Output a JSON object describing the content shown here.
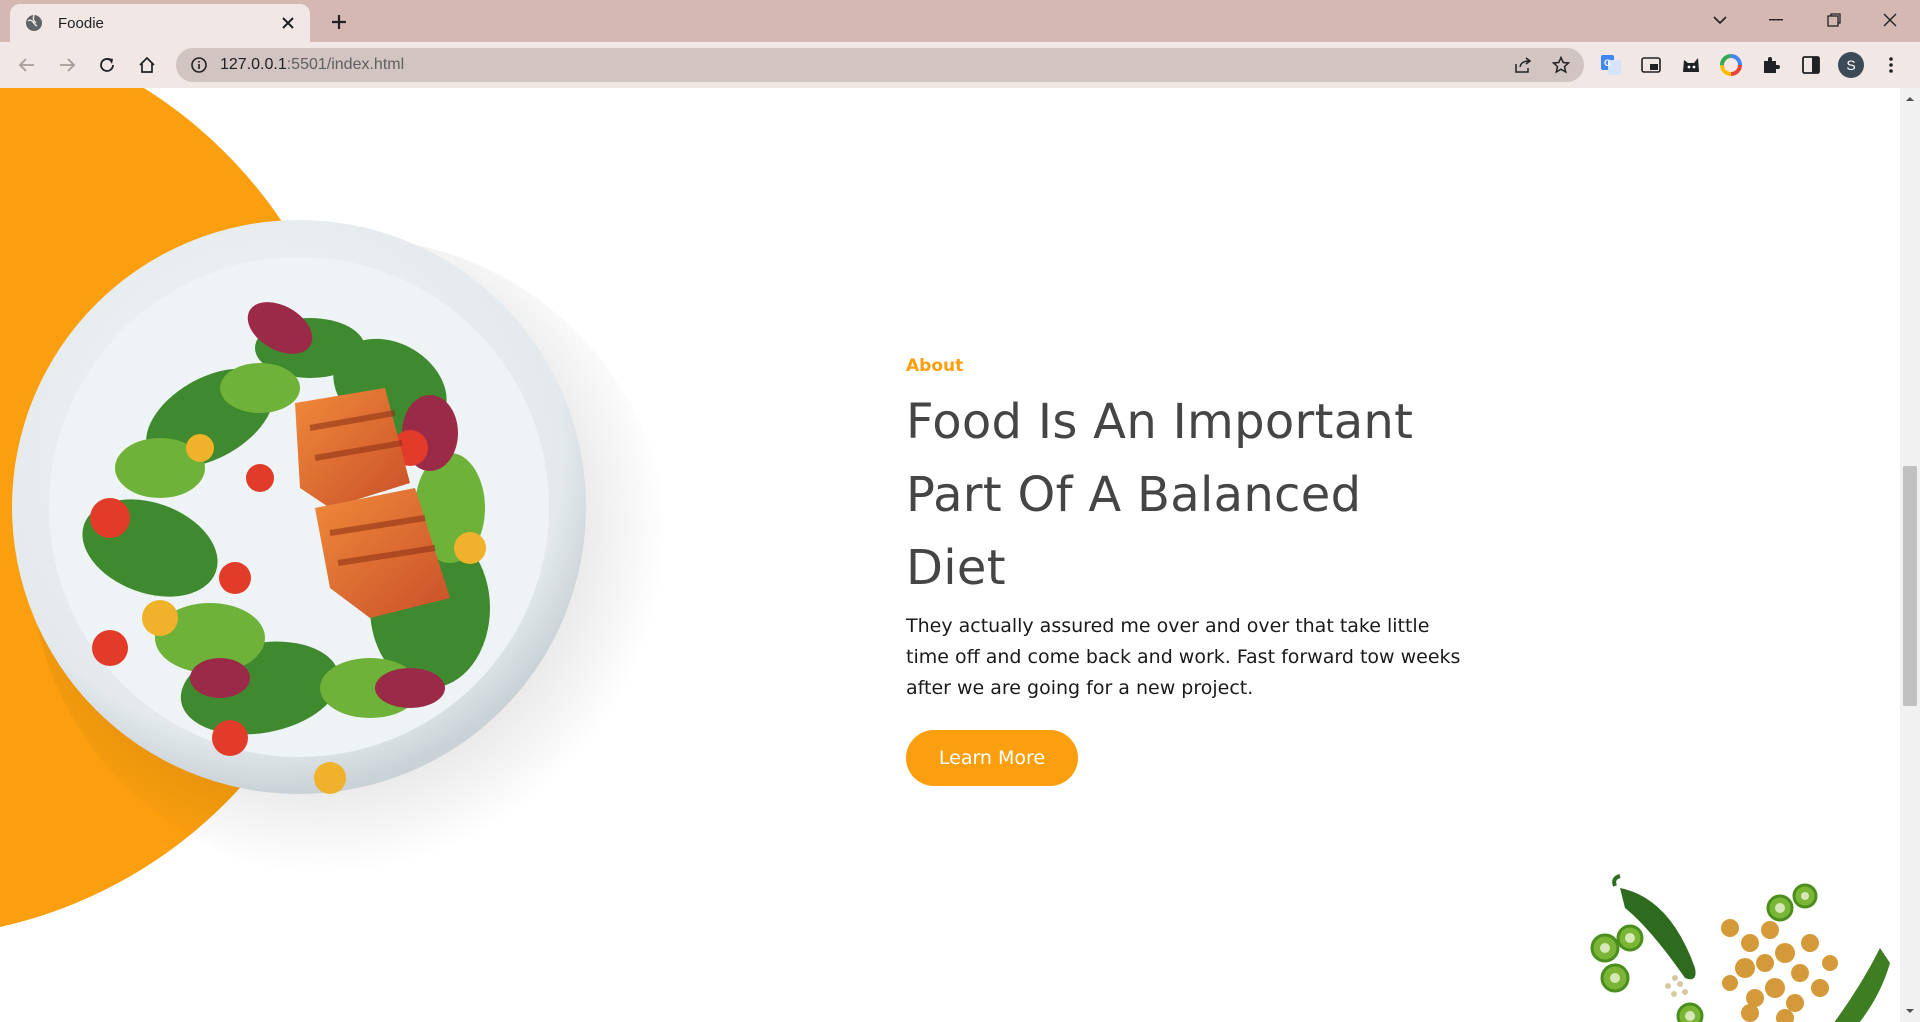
{
  "browser": {
    "tab_title": "Foodie",
    "url_host": "127.0.0.1",
    "url_path": ":5501/index.html",
    "profile_initial": "S"
  },
  "icons": {
    "favicon": "globe-icon",
    "close": "close-icon",
    "new_tab": "plus-icon",
    "back": "arrow-left-icon",
    "forward": "arrow-right-icon",
    "reload": "reload-icon",
    "home": "home-icon",
    "site_info": "info-icon",
    "share": "share-icon",
    "bookmark": "star-icon",
    "translate": "translate-icon",
    "pip": "picture-in-picture-icon",
    "ext_cat": "extension-cat-icon",
    "ext_color": "color-picker-icon",
    "extensions": "puzzle-icon",
    "side_panel": "side-panel-icon",
    "menu": "kebab-menu-icon"
  },
  "colors": {
    "accent": "#fb9f0e",
    "heading": "#454545",
    "tabbar": "#d5b8b1",
    "toolbar": "#f1e7e5"
  },
  "about": {
    "eyebrow": "About",
    "heading_line1": "Food Is An Important",
    "heading_line2": "Part Of A Balanced Diet",
    "paragraph": "They actually assured me over and over that take little time off and come back and work. Fast forward tow weeks after we are going for a new project.",
    "button_label": "Learn More"
  }
}
